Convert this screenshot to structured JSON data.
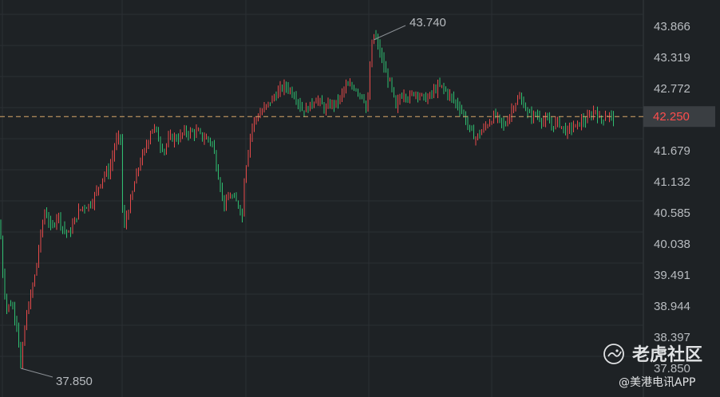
{
  "chart_data": {
    "type": "candlestick",
    "y_ticks": [
      "43.866",
      "43.319",
      "42.772",
      "42.225",
      "41.679",
      "41.132",
      "40.585",
      "40.038",
      "39.491",
      "38.944",
      "38.397",
      "37.850"
    ],
    "ylim": [
      37.85,
      43.866
    ],
    "current_price": "42.250",
    "current_value": 42.25,
    "high_label": "43.740",
    "high_value": 43.74,
    "low_label": "37.850",
    "low_value": 37.85,
    "grid": true,
    "colors": {
      "up": "#e84a4a",
      "down": "#2fbf71",
      "background": "#1e2225",
      "grid": "#2b3034",
      "price_line": "#d9a76a"
    },
    "path": [
      [
        0,
        40.4
      ],
      [
        3,
        39.6
      ],
      [
        8,
        38.9
      ],
      [
        14,
        39.0
      ],
      [
        22,
        38.6
      ],
      [
        26,
        37.85
      ],
      [
        32,
        38.7
      ],
      [
        38,
        39.1
      ],
      [
        44,
        39.5
      ],
      [
        48,
        39.9
      ],
      [
        52,
        40.3
      ],
      [
        56,
        40.6
      ],
      [
        60,
        40.5
      ],
      [
        64,
        40.3
      ],
      [
        68,
        40.4
      ],
      [
        72,
        40.6
      ],
      [
        76,
        40.4
      ],
      [
        80,
        40.3
      ],
      [
        86,
        40.2
      ],
      [
        92,
        40.4
      ],
      [
        98,
        40.6
      ],
      [
        104,
        40.7
      ],
      [
        110,
        40.7
      ],
      [
        116,
        40.8
      ],
      [
        122,
        41.0
      ],
      [
        128,
        41.2
      ],
      [
        132,
        41.3
      ],
      [
        136,
        41.3
      ],
      [
        140,
        41.5
      ],
      [
        144,
        41.8
      ],
      [
        148,
        41.9
      ],
      [
        152,
        41.9
      ],
      [
        154,
        40.2
      ],
      [
        158,
        40.5
      ],
      [
        164,
        40.8
      ],
      [
        170,
        41.2
      ],
      [
        176,
        41.5
      ],
      [
        182,
        41.7
      ],
      [
        188,
        42.0
      ],
      [
        192,
        42.1
      ],
      [
        196,
        42.0
      ],
      [
        200,
        41.8
      ],
      [
        206,
        41.7
      ],
      [
        212,
        41.9
      ],
      [
        218,
        41.9
      ],
      [
        224,
        41.9
      ],
      [
        230,
        42.0
      ],
      [
        236,
        42.0
      ],
      [
        242,
        42.0
      ],
      [
        248,
        42.0
      ],
      [
        254,
        41.9
      ],
      [
        260,
        41.9
      ],
      [
        266,
        41.8
      ],
      [
        270,
        41.5
      ],
      [
        274,
        41.2
      ],
      [
        278,
        40.9
      ],
      [
        282,
        40.7
      ],
      [
        288,
        40.9
      ],
      [
        294,
        40.8
      ],
      [
        300,
        40.7
      ],
      [
        304,
        40.5
      ],
      [
        306,
        41.2
      ],
      [
        310,
        41.6
      ],
      [
        314,
        42.0
      ],
      [
        318,
        42.2
      ],
      [
        324,
        42.3
      ],
      [
        330,
        42.4
      ],
      [
        336,
        42.5
      ],
      [
        342,
        42.6
      ],
      [
        348,
        42.7
      ],
      [
        354,
        42.8
      ],
      [
        360,
        42.8
      ],
      [
        366,
        42.7
      ],
      [
        372,
        42.6
      ],
      [
        378,
        42.4
      ],
      [
        384,
        42.4
      ],
      [
        390,
        42.5
      ],
      [
        396,
        42.6
      ],
      [
        402,
        42.5
      ],
      [
        408,
        42.4
      ],
      [
        414,
        42.5
      ],
      [
        420,
        42.5
      ],
      [
        426,
        42.6
      ],
      [
        432,
        42.8
      ],
      [
        438,
        42.8
      ],
      [
        444,
        42.8
      ],
      [
        450,
        42.7
      ],
      [
        456,
        42.6
      ],
      [
        460,
        42.3
      ],
      [
        464,
        43.3
      ],
      [
        468,
        43.74
      ],
      [
        472,
        43.6
      ],
      [
        476,
        43.4
      ],
      [
        480,
        43.2
      ],
      [
        484,
        43.0
      ],
      [
        488,
        42.9
      ],
      [
        492,
        42.7
      ],
      [
        496,
        42.4
      ],
      [
        500,
        42.6
      ],
      [
        506,
        42.7
      ],
      [
        512,
        42.6
      ],
      [
        518,
        42.7
      ],
      [
        524,
        42.7
      ],
      [
        530,
        42.6
      ],
      [
        536,
        42.6
      ],
      [
        542,
        42.7
      ],
      [
        548,
        42.8
      ],
      [
        554,
        42.8
      ],
      [
        560,
        42.7
      ],
      [
        566,
        42.6
      ],
      [
        572,
        42.5
      ],
      [
        578,
        42.4
      ],
      [
        584,
        42.2
      ],
      [
        590,
        42.0
      ],
      [
        596,
        41.9
      ],
      [
        602,
        42.0
      ],
      [
        608,
        42.1
      ],
      [
        614,
        42.2
      ],
      [
        620,
        42.3
      ],
      [
        626,
        42.2
      ],
      [
        632,
        42.1
      ],
      [
        638,
        42.3
      ],
      [
        644,
        42.5
      ],
      [
        650,
        42.6
      ],
      [
        656,
        42.5
      ],
      [
        662,
        42.3
      ],
      [
        668,
        42.3
      ],
      [
        674,
        42.3
      ],
      [
        680,
        42.2
      ],
      [
        686,
        42.2
      ],
      [
        692,
        42.1
      ],
      [
        698,
        42.2
      ],
      [
        704,
        42.1
      ],
      [
        710,
        42.0
      ],
      [
        716,
        42.1
      ],
      [
        722,
        42.1
      ],
      [
        728,
        42.2
      ],
      [
        734,
        42.2
      ],
      [
        740,
        42.3
      ],
      [
        746,
        42.4
      ],
      [
        752,
        42.2
      ],
      [
        758,
        42.3
      ],
      [
        764,
        42.3
      ],
      [
        770,
        42.25
      ]
    ]
  },
  "watermark": {
    "brand": "老虎社区",
    "sub": "@美港电讯APP"
  }
}
